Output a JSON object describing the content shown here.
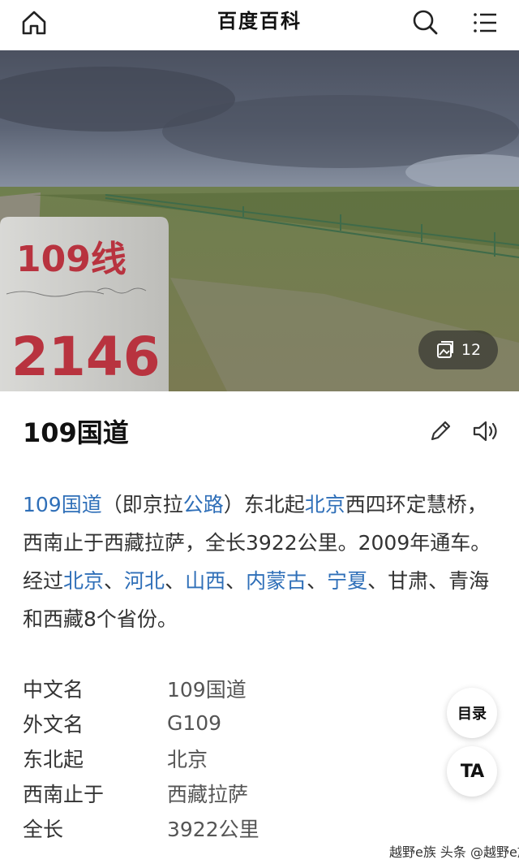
{
  "header": {
    "title": "百度百科",
    "icons": [
      "home-icon",
      "search-icon",
      "menu-icon"
    ]
  },
  "hero": {
    "milestone_route": "109线",
    "milestone_number": "2146",
    "gallery_count": "12"
  },
  "entry": {
    "title": "109国道"
  },
  "summary": [
    {
      "text": "109国道",
      "link": true
    },
    {
      "text": "（即京拉",
      "link": false
    },
    {
      "text": "公路",
      "link": true
    },
    {
      "text": "）东北起",
      "link": false
    },
    {
      "text": "北京",
      "link": true
    },
    {
      "text": "西四环定慧桥，西南止于西藏拉萨，全长3922公里。2009年通车。经过",
      "link": false
    },
    {
      "text": "北京",
      "link": true
    },
    {
      "text": "、",
      "link": false
    },
    {
      "text": "河北",
      "link": true
    },
    {
      "text": "、",
      "link": false
    },
    {
      "text": "山西",
      "link": true
    },
    {
      "text": "、",
      "link": false
    },
    {
      "text": "内蒙古",
      "link": true
    },
    {
      "text": "、",
      "link": false
    },
    {
      "text": "宁夏",
      "link": true
    },
    {
      "text": "、甘肃、青海和西藏8个省份。",
      "link": false
    }
  ],
  "info": [
    {
      "label": "中文名",
      "value": "109国道"
    },
    {
      "label": "外文名",
      "value": "G109"
    },
    {
      "label": "东北起",
      "value": "北京"
    },
    {
      "label": "西南止于",
      "value": "西藏拉萨"
    },
    {
      "label": "全长",
      "value": "3922公里"
    }
  ],
  "float": {
    "toc_label": "目录",
    "font_label": "TA"
  },
  "watermark": "越野e族 头条 @越野e族",
  "colors": {
    "link": "#2f6fb8",
    "text": "#333333"
  }
}
